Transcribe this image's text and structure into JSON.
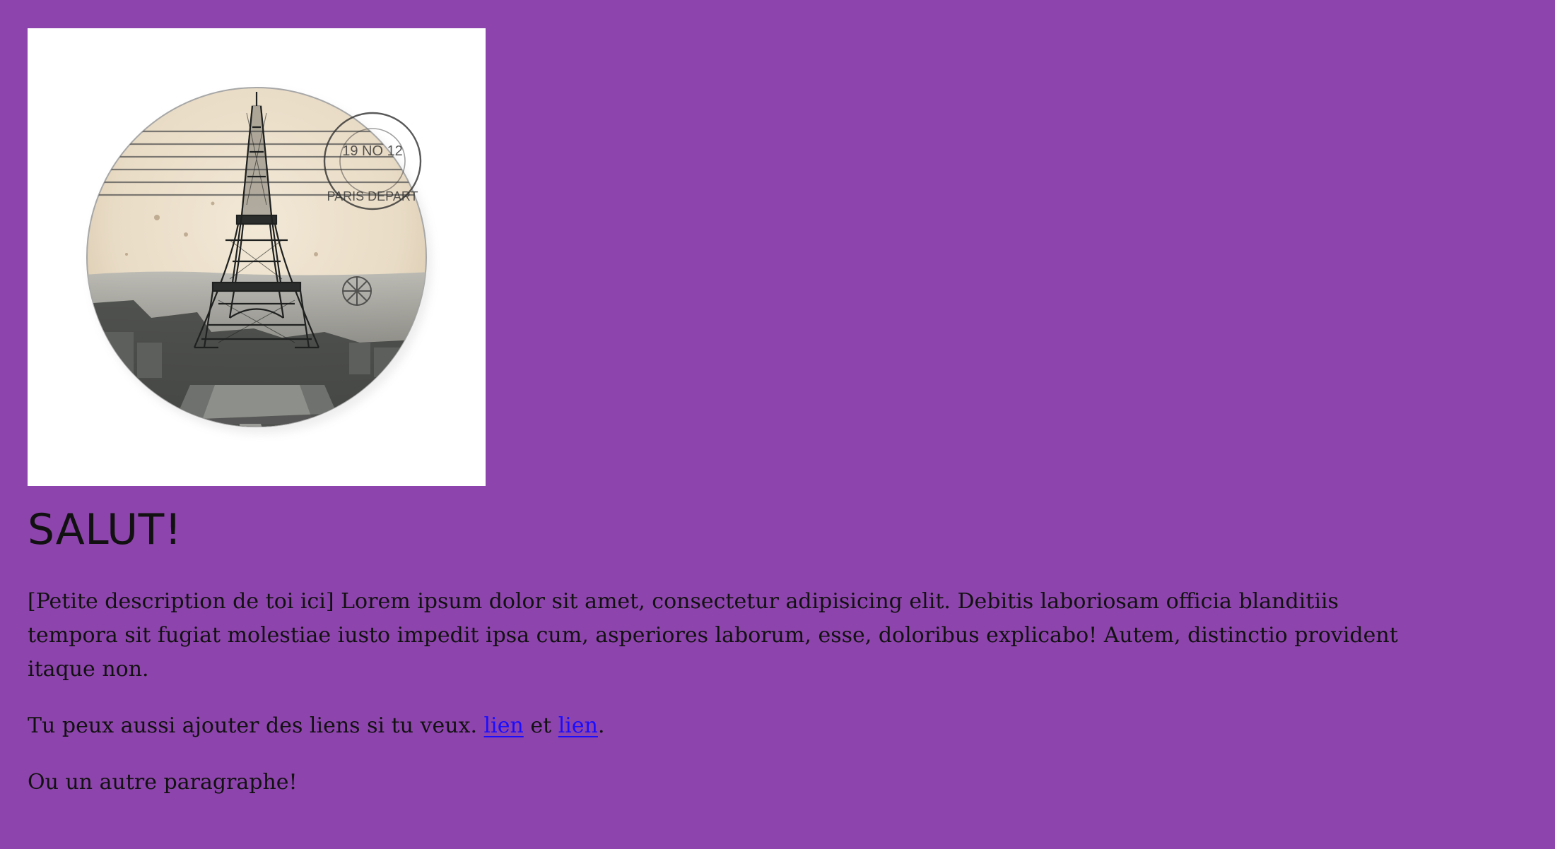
{
  "page": {
    "background_color": "#8e44ad"
  },
  "image": {
    "alt": "Eiffel Tower postcard sticker",
    "stamp": "PARIS DEPART"
  },
  "heading": {
    "title": "SALUT!"
  },
  "paragraphs": {
    "intro": "[Petite description de toi ici] Lorem ipsum dolor sit amet, consectetur adipisicing elit. Debitis laboriosam officia blanditiis tempora sit fugiat molestiae iusto impedit ipsa cum, asperiores laborum, esse, doloribus explicabo! Autem, distinctio provident itaque non.",
    "links_prefix": "Tu peux aussi ajouter des liens si tu veux. ",
    "link_1": "lien",
    "links_between": " et ",
    "link_2": "lien",
    "links_suffix": ".",
    "outro": "Ou un autre paragraphe!"
  },
  "colors": {
    "link": "#1a0dff",
    "text": "#111111",
    "image_frame": "#ffffff"
  }
}
